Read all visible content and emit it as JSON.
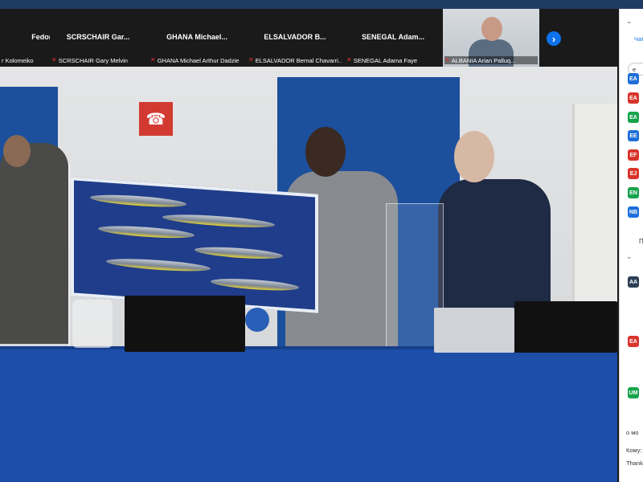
{
  "strip": {
    "tiles": [
      {
        "name": "Fedor K...",
        "label": "r Kolomeiko",
        "muted": false
      },
      {
        "name": "SCRSCHAIR Gar...",
        "label": "SCRSCHAIR Gary Melvin",
        "muted": true
      },
      {
        "name": "GHANA Michael...",
        "label": "GHANA Michael Arthur Dadzie",
        "muted": true
      },
      {
        "name": "ELSALVADOR B...",
        "label": "ELSALVADOR Bernal Chavarri...",
        "muted": true
      },
      {
        "name": "SENEGAL Adam...",
        "label": "SENEGAL Adama Faye",
        "muted": true
      },
      {
        "name": "",
        "label": "ALBANIA Arian Palluq...",
        "muted": true
      }
    ],
    "next_icon": "chevron-right-icon"
  },
  "panel": {
    "tab": "Чат",
    "search_value": "e",
    "badges": [
      {
        "text": "EA",
        "color": "#1e6fd9"
      },
      {
        "text": "EA",
        "color": "#d9342b"
      },
      {
        "text": "EA",
        "color": "#16a34a"
      },
      {
        "text": "EE",
        "color": "#1e6fd9"
      },
      {
        "text": "EF",
        "color": "#d9342b"
      },
      {
        "text": "EJ",
        "color": "#d9342b"
      },
      {
        "text": "EN",
        "color": "#16a34a"
      },
      {
        "text": "NB",
        "color": "#1e6fd9"
      }
    ],
    "section_label": "П",
    "chat_badges": [
      {
        "text": "AA",
        "color": "#2b3f57"
      },
      {
        "text": "EA",
        "color": "#d9342b"
      },
      {
        "text": "UM",
        "color": "#16a34a"
      }
    ],
    "footer_line1": "о мо",
    "footer_to": "Кому:",
    "footer_thanks": "Thanks"
  },
  "colors": {
    "accent": "#0e72ed",
    "muted_mic": "#e0302f",
    "banner": "#1c4f9c",
    "table": "#1d4ea8"
  }
}
